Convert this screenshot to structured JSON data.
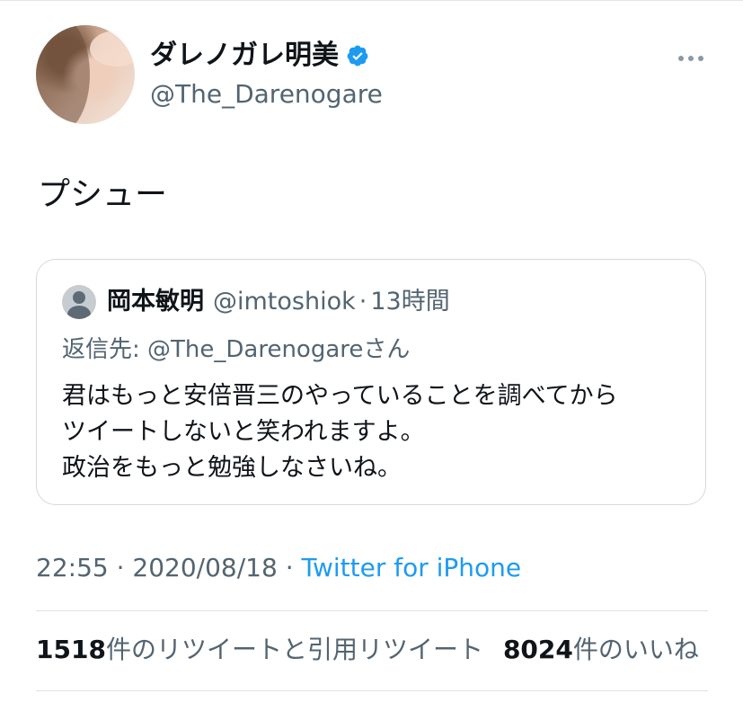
{
  "author": {
    "display_name": "ダレノガレ明美",
    "handle": "@The_Darenogare",
    "verified_icon": "verified-badge-icon",
    "avatar_icon": "profile-photo"
  },
  "tweet": {
    "text": "プシュー"
  },
  "quote": {
    "name": "岡本敏明",
    "handle": "@imtoshiok",
    "separator": "·",
    "time": "13時間",
    "reply_prefix": "返信先: ",
    "reply_handle": "@The_Darenogare",
    "reply_suffix": "さん",
    "lines": [
      "君はもっと安倍晋三のやっていることを調べてから",
      "ツイートしないと笑われますよ。",
      "政治をもっと勉強しなさいね。"
    ]
  },
  "meta": {
    "time": "22:55",
    "sep1": " · ",
    "date": "2020/08/18",
    "sep2": " · ",
    "source": "Twitter for iPhone"
  },
  "stats": {
    "retweets": "1518",
    "retweets_label": "件のリツイートと引用リツイート",
    "likes": "8024",
    "likes_label": "件のいいね"
  },
  "colors": {
    "accent": "#1d9bf0",
    "secondary_text": "#536471",
    "primary_text": "#0f1419"
  }
}
